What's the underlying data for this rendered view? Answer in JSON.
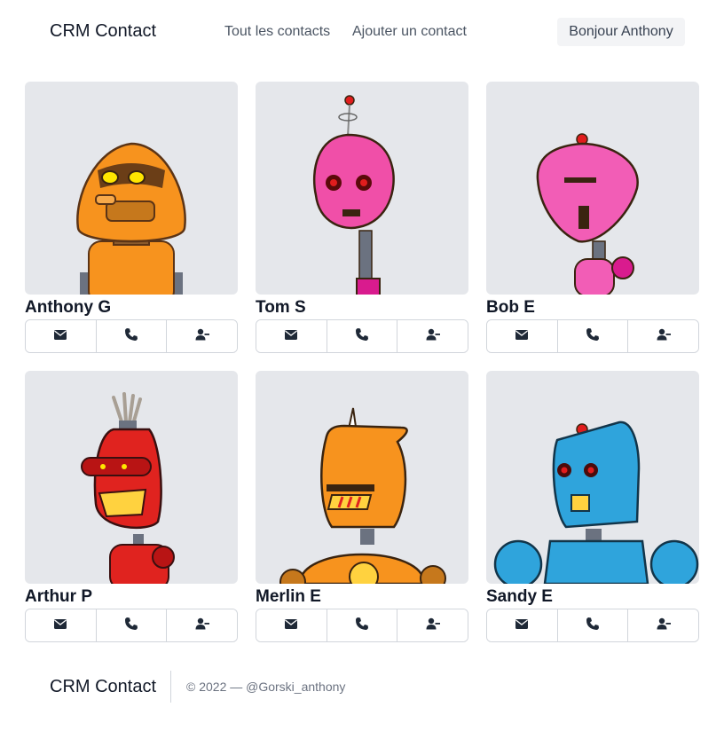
{
  "nav": {
    "brand": "CRM Contact",
    "links": [
      "Tout les contacts",
      "Ajouter un contact"
    ],
    "greeting": "Bonjour Anthony"
  },
  "contacts": [
    {
      "name": "Anthony G",
      "color": "#f7931e",
      "actions": [
        "envelope-icon",
        "phone-icon",
        "user-minus-icon"
      ]
    },
    {
      "name": "Tom S",
      "color": "#f04fa8",
      "actions": [
        "envelope-icon",
        "phone-icon",
        "user-minus-icon"
      ]
    },
    {
      "name": "Bob E",
      "color": "#f25db6",
      "actions": [
        "envelope-icon",
        "phone-icon",
        "user-minus-icon"
      ]
    },
    {
      "name": "Arthur P",
      "color": "#e0231f",
      "actions": [
        "envelope-icon",
        "phone-icon",
        "user-minus-icon"
      ]
    },
    {
      "name": "Merlin E",
      "color": "#f7931e",
      "actions": [
        "envelope-icon",
        "phone-icon",
        "user-minus-icon"
      ]
    },
    {
      "name": "Sandy E",
      "color": "#2fa4dc",
      "actions": [
        "envelope-icon",
        "phone-icon",
        "user-minus-icon"
      ]
    }
  ],
  "footer": {
    "brand": "CRM Contact",
    "copyright": "© 2022 — @Gorski_anthony"
  }
}
